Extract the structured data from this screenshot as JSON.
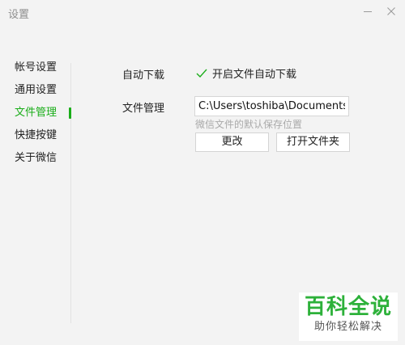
{
  "window": {
    "title": "设置"
  },
  "sidebar": {
    "items": [
      {
        "label": "帐号设置",
        "active": false
      },
      {
        "label": "通用设置",
        "active": false
      },
      {
        "label": "文件管理",
        "active": true
      },
      {
        "label": "快捷按键",
        "active": false
      },
      {
        "label": "关于微信",
        "active": false
      }
    ]
  },
  "main": {
    "auto_download": {
      "label": "自动下载",
      "checkbox_label": "开启文件自动下载",
      "checked": true
    },
    "file_management": {
      "label": "文件管理",
      "path_value": "C:\\Users\\toshiba\\Documents",
      "hint": "微信文件的默认保存位置",
      "change_button": "更改",
      "open_folder_button": "打开文件夹"
    }
  },
  "watermark": {
    "brand": "百科全说",
    "slogan": "助你轻松解决"
  },
  "colors": {
    "accent": "#1aad19",
    "background": "#f3f3f3",
    "hint": "#a9a9a9"
  }
}
